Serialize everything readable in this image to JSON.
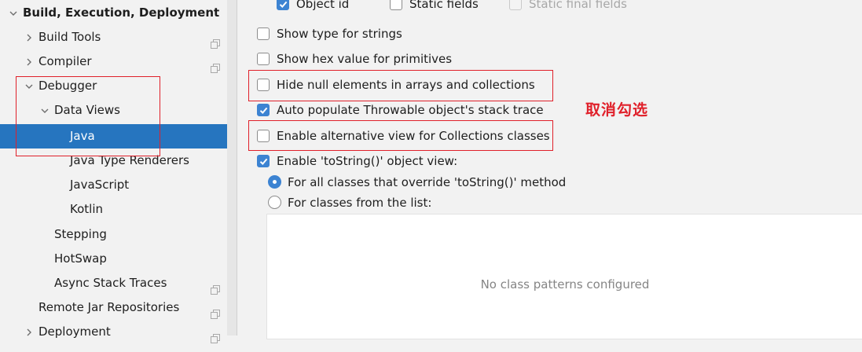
{
  "sidebar": {
    "items": [
      {
        "label": "Build, Execution, Deployment",
        "arrow": "chevron-down",
        "bold": true,
        "copy": false
      },
      {
        "label": "Build Tools",
        "arrow": "chevron-right",
        "copy": true
      },
      {
        "label": "Compiler",
        "arrow": "chevron-right",
        "copy": true
      },
      {
        "label": "Debugger",
        "arrow": "chevron-down",
        "copy": false
      },
      {
        "label": "Data Views",
        "arrow": "chevron-down",
        "copy": false
      },
      {
        "label": "Java",
        "arrow": "",
        "copy": false,
        "selected": true
      },
      {
        "label": "Java Type Renderers",
        "arrow": "",
        "copy": false
      },
      {
        "label": "JavaScript",
        "arrow": "",
        "copy": false
      },
      {
        "label": "Kotlin",
        "arrow": "",
        "copy": false
      },
      {
        "label": "Stepping",
        "arrow": "",
        "copy": false
      },
      {
        "label": "HotSwap",
        "arrow": "",
        "copy": false
      },
      {
        "label": "Async Stack Traces",
        "arrow": "",
        "copy": true
      },
      {
        "label": "Remote Jar Repositories",
        "arrow": "",
        "copy": true
      },
      {
        "label": "Deployment",
        "arrow": "chevron-right",
        "copy": true
      }
    ]
  },
  "main": {
    "top_row": [
      {
        "label": "Object id",
        "checked": true,
        "disabled": false
      },
      {
        "label": "Static fields",
        "checked": false,
        "disabled": false
      },
      {
        "label": "Static final fields",
        "checked": false,
        "disabled": true
      }
    ],
    "options": [
      {
        "label": "Show type for strings",
        "checked": false
      },
      {
        "label": "Show hex value for primitives",
        "checked": false
      },
      {
        "label": "Hide null elements in arrays and collections",
        "checked": false
      },
      {
        "label": "Auto populate Throwable object's stack trace",
        "checked": true
      },
      {
        "label": "Enable alternative view for Collections classes",
        "checked": false
      },
      {
        "label": "Enable 'toString()' object view:",
        "checked": true
      }
    ],
    "radios": [
      {
        "label": "For all classes that override 'toString()' method",
        "checked": true
      },
      {
        "label": "For classes from the list:",
        "checked": false
      }
    ],
    "class_list_empty": "No class patterns configured",
    "annotation": "取消勾选"
  },
  "colors": {
    "selection": "#2675bf",
    "checkbox_checked": "#3c83d2",
    "annotation_red": "#e0202a"
  }
}
